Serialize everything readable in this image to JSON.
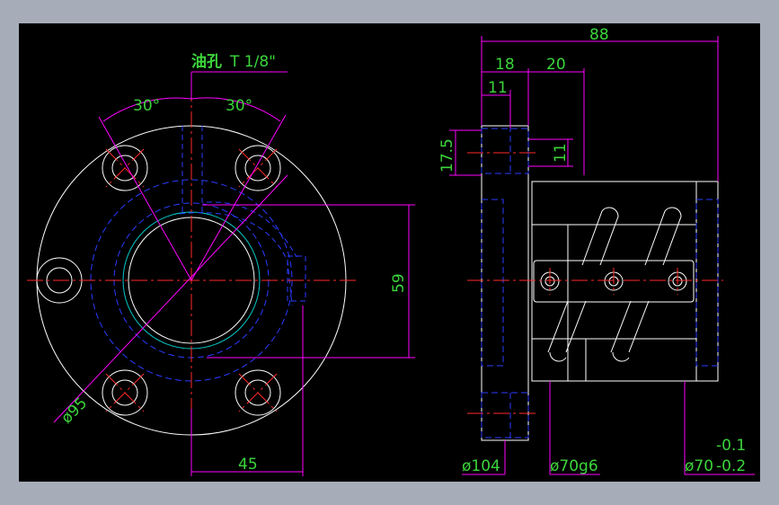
{
  "drawing": {
    "note_prefix": "油孔",
    "note_suffix": "T 1/8\"",
    "dims": {
      "angle_left": "30°",
      "angle_right": "30°",
      "dia95": "ø95",
      "h59": "59",
      "w45": "45",
      "w88": "88",
      "w18": "18",
      "w20": "20",
      "w11": "11",
      "h17_5": "17.5",
      "h11": "11",
      "dia104": "ø104",
      "dia70g6": "ø70g6",
      "dia70": "ø70",
      "tol_upper": "-0.1",
      "tol_lower": "-0.2"
    },
    "colors": {
      "background": "#000000",
      "frame": "#a6adb9",
      "outline": "#ffffff",
      "dimension": "#ff00ff",
      "centerline": "#ff2a2a",
      "hidden": "#2a3cff",
      "text": "#3cd53c",
      "cyan": "#00c8c8"
    }
  }
}
